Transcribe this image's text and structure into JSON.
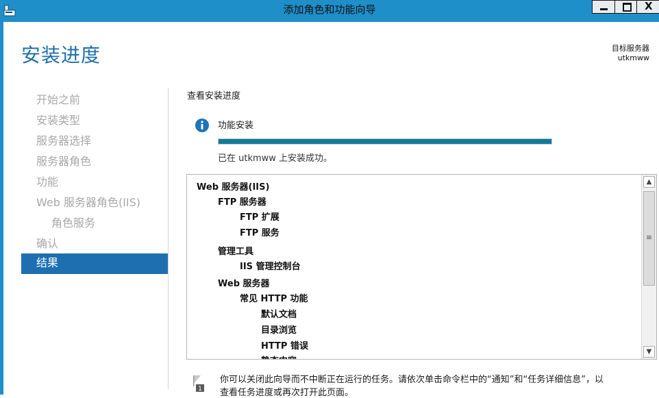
{
  "window": {
    "title": "添加角色和功能向导",
    "close_glyph": "X"
  },
  "header": {
    "page_title": "安装进度",
    "target_label": "目标服务器",
    "target_value": "utkmww"
  },
  "nav": {
    "items": [
      {
        "label": "开始之前"
      },
      {
        "label": "安装类型"
      },
      {
        "label": "服务器选择"
      },
      {
        "label": "服务器角色"
      },
      {
        "label": "功能"
      },
      {
        "label": "Web 服务器角色(IIS)"
      },
      {
        "label": "角色服务"
      },
      {
        "label": "确认"
      },
      {
        "label": "结果"
      }
    ],
    "active_index": 8
  },
  "content": {
    "section_title": "查看安装进度",
    "feature_label": "功能安装",
    "progress": 1.0,
    "success_text": "已在 utkmww 上安装成功。",
    "tree": [
      {
        "label": "Web 服务器(IIS)"
      },
      {
        "label": "FTP 服务器"
      },
      {
        "label": "FTP 扩展"
      },
      {
        "label": "FTP 服务"
      },
      {
        "label": "管理工具"
      },
      {
        "label": "IIS 管理控制台"
      },
      {
        "label": "Web 服务器"
      },
      {
        "label": "常见 HTTP 功能"
      },
      {
        "label": "默认文档"
      },
      {
        "label": "目录浏览"
      },
      {
        "label": "HTTP 错误"
      },
      {
        "label": "静态内容"
      }
    ]
  },
  "footer": {
    "note_line1": "你可以关闭此向导而不中断正在运行的任务。请依次单击命令栏中的“通知”和“任务详细信息”，以",
    "note_line2": "查看任务进度或再次打开此页面。",
    "note_badge": "1"
  },
  "colors": {
    "titlebar": "#1e8fc9",
    "accent_title": "#1f6fa8",
    "nav_active": "#1e6fb0",
    "progress": "#117a9c"
  }
}
